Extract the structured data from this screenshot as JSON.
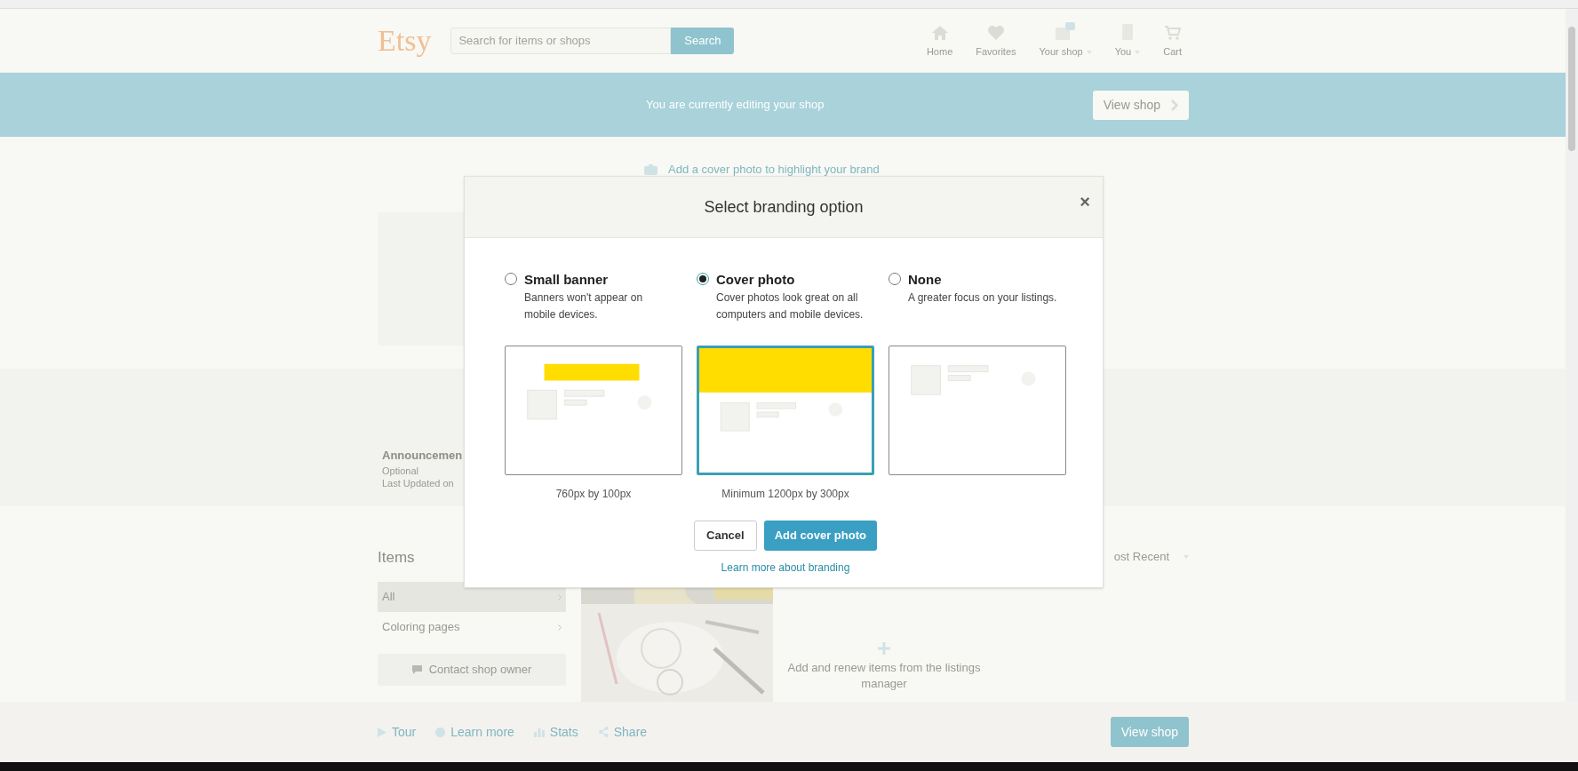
{
  "header": {
    "logo": "Etsy",
    "search_placeholder": "Search for items or shops",
    "search_button": "Search",
    "nav": [
      {
        "kind": "home",
        "label": "Home",
        "caret": false
      },
      {
        "kind": "heart",
        "label": "Favorites",
        "caret": false
      },
      {
        "kind": "shop",
        "label": "Your shop",
        "caret": true
      },
      {
        "kind": "you",
        "label": "You",
        "caret": true
      },
      {
        "kind": "cart",
        "label": "Cart",
        "caret": false
      }
    ]
  },
  "banner": {
    "text": "You are currently editing your shop",
    "button": "View shop"
  },
  "cover_prompt": "Add a cover photo to highlight your brand",
  "announcement": {
    "title": "Announcemen",
    "lines": [
      "Optional",
      "Last Updated on"
    ]
  },
  "items": {
    "title": "Items",
    "sections": [
      {
        "label": "All",
        "selected": true
      },
      {
        "label": "Coloring pages",
        "selected": false
      }
    ],
    "contact": "Contact shop owner",
    "sort": "ost Recent",
    "add_text": "Add and renew items from the listings manager"
  },
  "footer": {
    "links": [
      {
        "kind": "tour",
        "label": "Tour"
      },
      {
        "kind": "help",
        "label": "Learn more"
      },
      {
        "kind": "stats",
        "label": "Stats"
      },
      {
        "kind": "share",
        "label": "Share"
      }
    ],
    "button": "View shop"
  },
  "modal": {
    "title": "Select branding option",
    "close": "×",
    "options": [
      {
        "kind": "banner",
        "title": "Small banner",
        "description": "Banners won't appear on mobile devices.",
        "size": "760px by 100px",
        "selected": false
      },
      {
        "kind": "cover",
        "title": "Cover photo",
        "description": "Cover photos look great on all computers and mobile devices.",
        "size": "Minimum 1200px by 300px",
        "selected": true
      },
      {
        "kind": "none",
        "title": "None",
        "description": "A greater focus on your listings.",
        "selected": false
      }
    ],
    "cancel": "Cancel",
    "confirm": "Add cover photo",
    "link": "Learn more about branding"
  }
}
